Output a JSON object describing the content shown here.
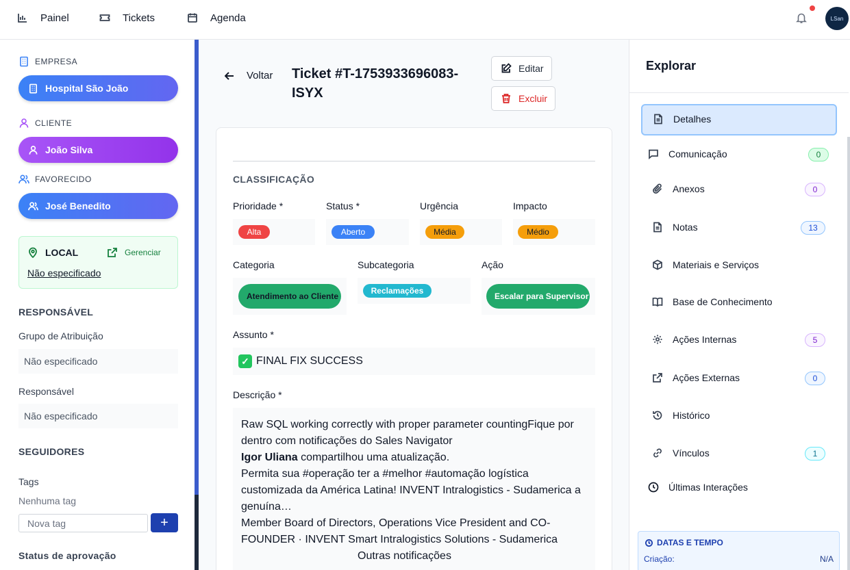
{
  "topnav": {
    "items": [
      {
        "label": "Painel",
        "icon": "bar-chart-icon"
      },
      {
        "label": "Tickets",
        "icon": "ticket-icon"
      },
      {
        "label": "Agenda",
        "icon": "calendar-icon"
      }
    ],
    "avatar_text": "LSan"
  },
  "sidebar": {
    "empresa": {
      "label": "EMPRESA",
      "value": "Hospital São João"
    },
    "cliente": {
      "label": "CLIENTE",
      "value": "João Silva"
    },
    "favorecido": {
      "label": "FAVORECIDO",
      "value": "José Benedito"
    },
    "local": {
      "label": "LOCAL",
      "manage": "Gerenciar",
      "value": "Não especificado"
    },
    "responsavel_heading": "RESPONSÁVEL",
    "grupo": {
      "label": "Grupo de Atribuição",
      "value": "Não especificado"
    },
    "responsavel": {
      "label": "Responsável",
      "value": "Não especificado"
    },
    "seguidores_heading": "SEGUIDORES",
    "tags": {
      "label": "Tags",
      "empty": "Nenhuma tag",
      "placeholder": "Nova tag",
      "add": "+"
    },
    "aprovacao": "Status de aprovação"
  },
  "header": {
    "back": "Voltar",
    "title": "Ticket #T-1753933696083-ISYX",
    "edit": "Editar",
    "delete": "Excluir"
  },
  "classification": {
    "heading": "CLASSIFICAÇÃO",
    "prioridade": {
      "label": "Prioridade *",
      "value": "Alta",
      "color": "#ef4444"
    },
    "status": {
      "label": "Status *",
      "value": "Aberto",
      "color": "#3b82f6"
    },
    "urgencia": {
      "label": "Urgência",
      "value": "Média",
      "color": "#f59e0b"
    },
    "impacto": {
      "label": "Impacto",
      "value": "Médio",
      "color": "#f59e0b"
    },
    "categoria": {
      "label": "Categoria",
      "value": "Atendimento ao Cliente",
      "color": "#22a96b"
    },
    "subcategoria": {
      "label": "Subcategoria",
      "value": "Reclamações",
      "color": "#22b8cf"
    },
    "acao": {
      "label": "Ação",
      "value": "Escalar para Supervisor",
      "color": "#22a96b"
    }
  },
  "subject": {
    "label": "Assunto *",
    "value": "FINAL FIX SUCCESS"
  },
  "description": {
    "label": "Descrição *",
    "lines": [
      "Raw SQL working correctly with proper parameter countingFique por",
      "dentro com notificações do Sales Navigator",
      "compartilhou uma atualização.",
      "Permita sua #operação ter a #melhor #automação logística",
      "customizada da América Latina! INVENT Intralogistics - Sudamerica a",
      "genuína…",
      "Member Board of Directors, Operations Vice President and CO-",
      "FOUNDER · INVENT Smart Intralogistics Solutions - Sudamerica",
      "Outras notificações"
    ],
    "bold_name": "Igor Uliana"
  },
  "explore": {
    "heading": "Explorar",
    "items": [
      {
        "label": "Detalhes",
        "icon": "document-icon"
      },
      {
        "label": "Comunicação",
        "icon": "chat-icon",
        "count": "0"
      },
      {
        "label": "Anexos",
        "icon": "paperclip-icon",
        "count": "0"
      },
      {
        "label": "Notas",
        "icon": "note-icon",
        "count": "13"
      },
      {
        "label": "Materiais e Serviços",
        "icon": "package-icon"
      },
      {
        "label": "Base de Conhecimento",
        "icon": "book-icon"
      },
      {
        "label": "Ações Internas",
        "icon": "gear-icon",
        "count": "5"
      },
      {
        "label": "Ações Externas",
        "icon": "external-link-icon",
        "count": "0"
      },
      {
        "label": "Histórico",
        "icon": "history-icon"
      },
      {
        "label": "Vínculos",
        "icon": "link-icon",
        "count": "1"
      },
      {
        "label": "Últimas Interações",
        "icon": "clock-icon"
      }
    ],
    "dates": {
      "title": "DATAS E TEMPO",
      "creation_label": "Criação:",
      "creation_value": "N/A"
    }
  },
  "colors": {
    "primary": "#3b82f6",
    "purple": "#a855f7",
    "success": "#15803d",
    "danger": "#dc2626"
  }
}
